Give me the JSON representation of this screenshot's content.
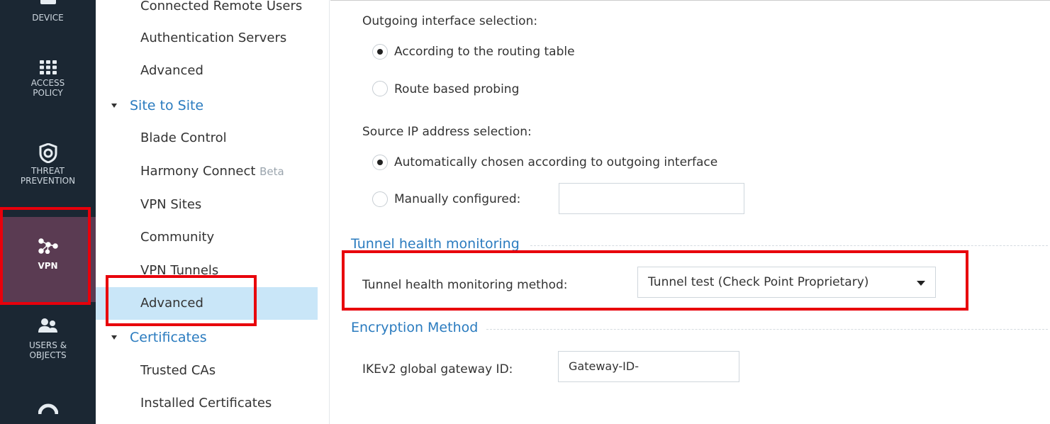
{
  "rail": {
    "items": [
      {
        "label": "DEVICE",
        "icon": "device-icon"
      },
      {
        "label": "ACCESS\nPOLICY",
        "icon": "grid-icon"
      },
      {
        "label": "THREAT\nPREVENTION",
        "icon": "shield-icon"
      },
      {
        "label": "VPN",
        "icon": "vpn-network-icon",
        "active": true
      },
      {
        "label": "USERS &\nOBJECTS",
        "icon": "users-icon"
      },
      {
        "label": "",
        "icon": "gauge-icon"
      }
    ],
    "active_color": "#5a3b52",
    "bg_color": "#1b2733"
  },
  "tree": {
    "remote_users": "Connected Remote Users",
    "auth_servers": "Authentication Servers",
    "advanced_ra": "Advanced",
    "site_to_site": "Site to Site",
    "blade_control": "Blade Control",
    "harmony_connect": "Harmony Connect",
    "harmony_beta": "Beta",
    "vpn_sites": "VPN Sites",
    "community": "Community",
    "vpn_tunnels": "VPN Tunnels",
    "advanced_s2s": "Advanced",
    "certificates": "Certificates",
    "trusted_cas": "Trusted CAs",
    "installed_certs": "Installed Certificates",
    "selected_color": "#c9e6f8"
  },
  "main": {
    "outgoing_label": "Outgoing interface selection:",
    "outgoing_opt1": "According to the routing table",
    "outgoing_opt2": "Route based probing",
    "source_label": "Source IP address selection:",
    "source_opt1": "Automatically chosen according to outgoing interface",
    "source_opt2": "Manually configured:",
    "source_manual_value": "",
    "tunnel_section": "Tunnel health monitoring",
    "tunnel_method_label": "Tunnel health monitoring method:",
    "tunnel_method_value": "Tunnel test (Check Point Proprietary)",
    "encryption_section": "Encryption Method",
    "ikev2_label": "IKEv2 global gateway ID:",
    "ikev2_value": "Gateway-ID-",
    "section_color": "#2a7bbf",
    "highlight_color": "#e8000b"
  }
}
